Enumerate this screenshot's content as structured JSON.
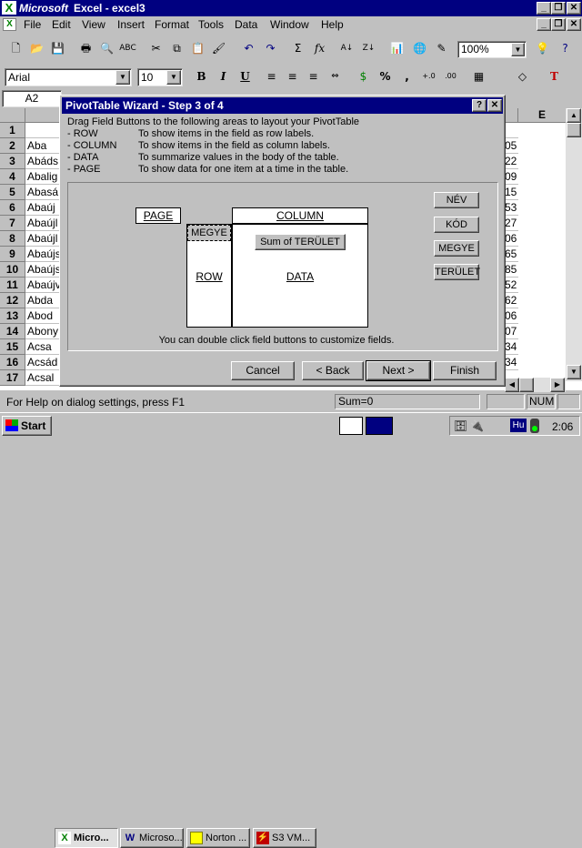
{
  "app": {
    "title_brand": "Microsoft",
    "title_rest": " Excel - excel3"
  },
  "menu": [
    "File",
    "Edit",
    "View",
    "Insert",
    "Format",
    "Tools",
    "Data",
    "Window",
    "Help"
  ],
  "toolbar": {
    "zoom": "100%"
  },
  "format": {
    "font": "Arial",
    "size": "10",
    "bold": "B",
    "italic": "I",
    "underline": "U",
    "percent": "%",
    "comma": ","
  },
  "namebox": "A2",
  "columns": {
    "e": "E"
  },
  "rows": [
    {
      "n": "1",
      "a": "",
      "r": ""
    },
    {
      "n": "2",
      "a": "Aba",
      "r": "05"
    },
    {
      "n": "3",
      "a": "Abáds",
      "r": "22"
    },
    {
      "n": "4",
      "a": "Abalig",
      "r": "09"
    },
    {
      "n": "5",
      "a": "Abasá",
      "r": "15"
    },
    {
      "n": "6",
      "a": "Abaúj",
      "r": "53"
    },
    {
      "n": "7",
      "a": "Abaújl",
      "r": "27"
    },
    {
      "n": "8",
      "a": "Abaújl",
      "r": "06"
    },
    {
      "n": "9",
      "a": "Abaújs",
      "r": "65"
    },
    {
      "n": "10",
      "a": "Abaújs",
      "r": "85"
    },
    {
      "n": "11",
      "a": "Abaújv",
      "r": "52"
    },
    {
      "n": "12",
      "a": "Abda",
      "r": "62"
    },
    {
      "n": "13",
      "a": "Abod",
      "r": "06"
    },
    {
      "n": "14",
      "a": "Abony",
      "r": "07"
    },
    {
      "n": "15",
      "a": "Acsa",
      "r": "34"
    },
    {
      "n": "16",
      "a": "Acsád",
      "r": "34"
    },
    {
      "n": "17",
      "a": "Acsal",
      "r": ""
    }
  ],
  "dialog": {
    "title": "PivotTable Wizard - Step 3 of 4",
    "help": "?",
    "close": "✕",
    "intro": "Drag Field Buttons to the following areas to layout your PivotTable",
    "lines": [
      {
        "k": " - ROW",
        "v": "To show items in the field as row labels."
      },
      {
        "k": " - COLUMN",
        "v": "To show items in the field as column labels."
      },
      {
        "k": " - DATA",
        "v": "To summarize values in the body of the table."
      },
      {
        "k": " - PAGE",
        "v": "To show data for one item at a time in the table."
      }
    ],
    "page": "PAGE",
    "column": "COLUMN",
    "row_field": "MEGYE",
    "row": "ROW",
    "data_field": "Sum of TERÜLET",
    "data": "DATA",
    "fields": [
      "NÉV",
      "KÓD",
      "MEGYE",
      "TERÜLET"
    ],
    "hint": "You can double click field buttons to customize fields.",
    "buttons": {
      "cancel": "Cancel",
      "back": "< Back",
      "next": "Next >",
      "finish": "Finish"
    }
  },
  "status": {
    "help": "For Help on dialog settings, press F1",
    "sum": "Sum=0",
    "num": "NUM"
  },
  "taskbar": {
    "start": "Start",
    "items": [
      "Micro...",
      "Microso...",
      "Norton ...",
      "S3 VM..."
    ],
    "lang": "Hu",
    "clock": "2:06"
  }
}
